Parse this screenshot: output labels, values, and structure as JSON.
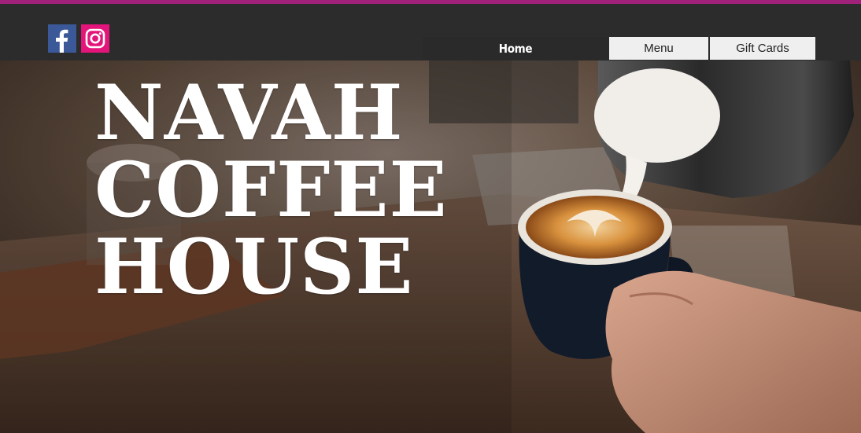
{
  "colors": {
    "accent": "#a0217a",
    "header_bg": "#2c2c2c",
    "facebook": "#3b5998",
    "instagram": "#e4157a"
  },
  "social": {
    "icons": [
      "facebook-icon",
      "instagram-icon"
    ]
  },
  "nav": {
    "items": [
      {
        "label": "Home"
      },
      {
        "label": "Menu"
      },
      {
        "label": "Gift Cards"
      }
    ]
  },
  "hero": {
    "title_lines": [
      "NAVAH",
      "COFFEE",
      "HOUSE"
    ]
  }
}
